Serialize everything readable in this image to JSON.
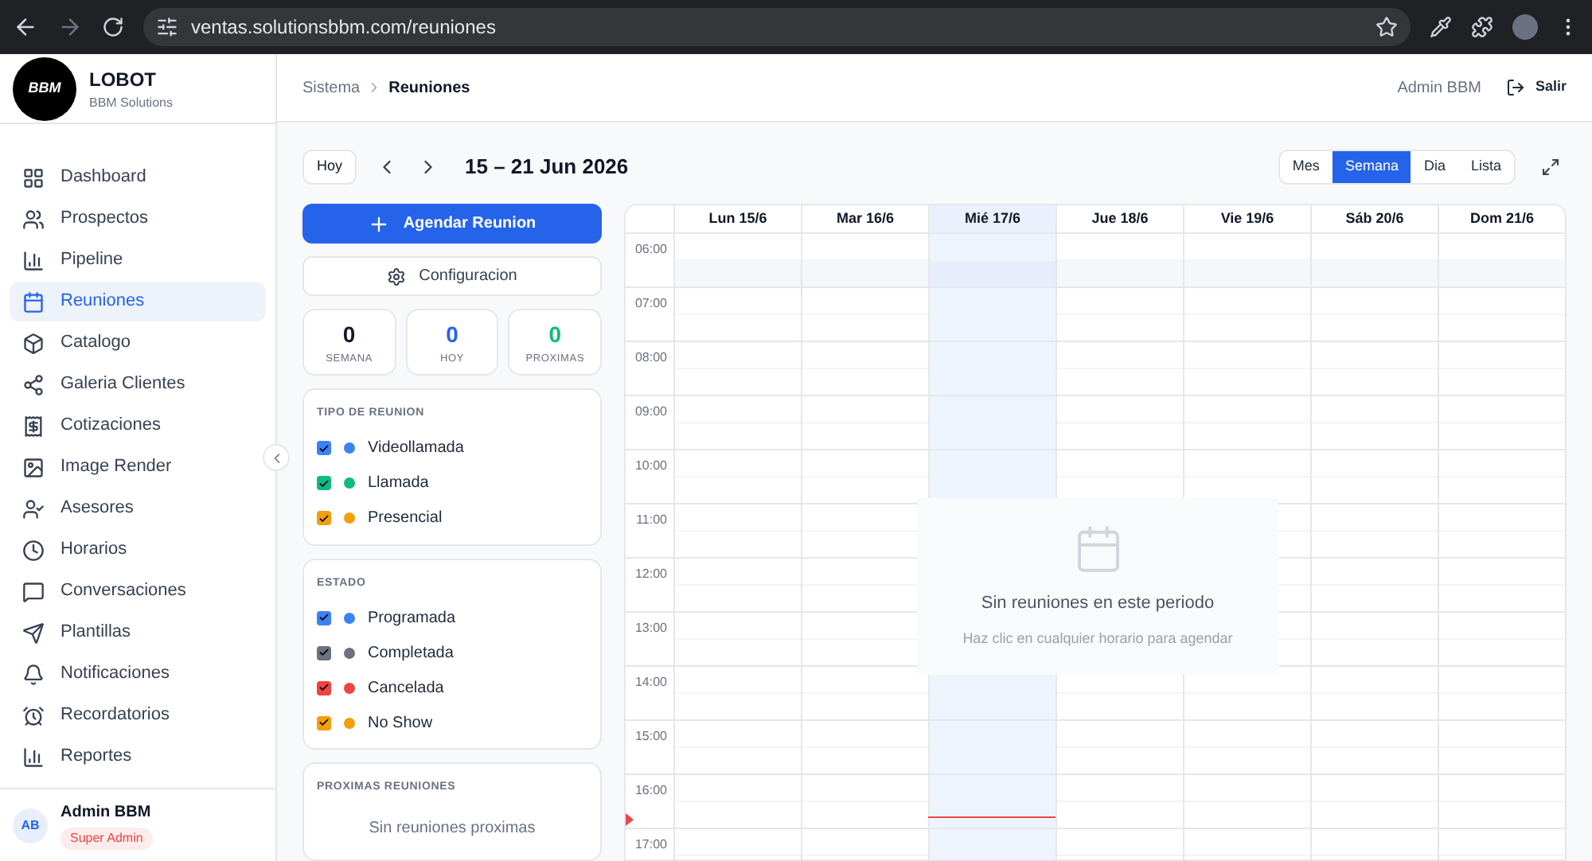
{
  "browser": {
    "url": "ventas.solutionsbbm.com/reuniones"
  },
  "sidebar": {
    "brand": {
      "name": "LOBOT",
      "subtitle": "BBM Solutions",
      "logo_text": "BBM"
    },
    "items": [
      {
        "label": "Dashboard",
        "selected": false
      },
      {
        "label": "Prospectos",
        "selected": false
      },
      {
        "label": "Pipeline",
        "selected": false
      },
      {
        "label": "Reuniones",
        "selected": true
      },
      {
        "label": "Catalogo",
        "selected": false
      },
      {
        "label": "Galeria Clientes",
        "selected": false
      },
      {
        "label": "Cotizaciones",
        "selected": false
      },
      {
        "label": "Image Render",
        "selected": false
      },
      {
        "label": "Asesores",
        "selected": false
      },
      {
        "label": "Horarios",
        "selected": false
      },
      {
        "label": "Conversaciones",
        "selected": false
      },
      {
        "label": "Plantillas",
        "selected": false
      },
      {
        "label": "Notificaciones",
        "selected": false
      },
      {
        "label": "Recordatorios",
        "selected": false
      },
      {
        "label": "Reportes",
        "selected": false
      }
    ],
    "user": {
      "initials": "AB",
      "name": "Admin BBM",
      "role": "Super Admin"
    }
  },
  "header": {
    "breadcrumb": [
      "Sistema",
      "Reuniones"
    ],
    "user": "Admin BBM",
    "logout": "Salir"
  },
  "toolbar": {
    "today": "Hoy",
    "range": "15 – 21 Jun 2026",
    "views": [
      {
        "label": "Mes",
        "selected": false
      },
      {
        "label": "Semana",
        "selected": true
      },
      {
        "label": "Dia",
        "selected": false
      },
      {
        "label": "Lista",
        "selected": false
      }
    ]
  },
  "actions": {
    "primary": "Agendar Reunion",
    "secondary": "Configuracion"
  },
  "stats": [
    {
      "value": "0",
      "label": "SEMANA",
      "color": "#111827"
    },
    {
      "value": "0",
      "label": "HOY",
      "color": "#2563eb"
    },
    {
      "value": "0",
      "label": "PROXIMAS",
      "color": "#10b981"
    }
  ],
  "filters": [
    {
      "title": "TIPO DE REUNION",
      "items": [
        {
          "label": "Videollamada",
          "checked": true,
          "color": "#3b82f6"
        },
        {
          "label": "Llamada",
          "checked": true,
          "color": "#10b981"
        },
        {
          "label": "Presencial",
          "checked": true,
          "color": "#f59e0b"
        }
      ]
    },
    {
      "title": "ESTADO",
      "items": [
        {
          "label": "Programada",
          "checked": true,
          "color": "#3b82f6"
        },
        {
          "label": "Completada",
          "checked": true,
          "color": "#6b7280"
        },
        {
          "label": "Cancelada",
          "checked": true,
          "color": "#ef4444"
        },
        {
          "label": "No Show",
          "checked": true,
          "color": "#f59e0b"
        }
      ]
    }
  ],
  "upcoming": {
    "title": "PROXIMAS REUNIONES",
    "empty": "Sin reuniones proximas"
  },
  "calendar": {
    "days": [
      {
        "label": "Lun 15/6",
        "today": false
      },
      {
        "label": "Mar 16/6",
        "today": false
      },
      {
        "label": "Mié 17/6",
        "today": true
      },
      {
        "label": "Jue 18/6",
        "today": false
      },
      {
        "label": "Vie 19/6",
        "today": false
      },
      {
        "label": "Sáb 20/6",
        "today": false
      },
      {
        "label": "Dom 21/6",
        "today": false
      }
    ],
    "hours": [
      "06:00",
      "07:00",
      "08:00",
      "09:00",
      "10:00",
      "11:00",
      "12:00",
      "13:00",
      "14:00",
      "15:00",
      "16:00",
      "17:00"
    ],
    "empty_title": "Sin reuniones en este periodo",
    "empty_hint": "Haz clic en cualquier horario para agendar"
  }
}
